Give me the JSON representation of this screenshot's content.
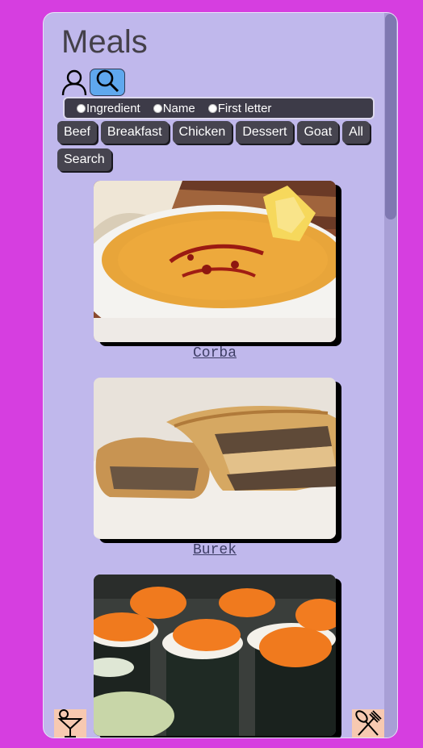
{
  "app": {
    "title": "Meals"
  },
  "search_modes": [
    {
      "label": "Ingredient"
    },
    {
      "label": "Name"
    },
    {
      "label": "First letter"
    }
  ],
  "categories": [
    "Beef",
    "Breakfast",
    "Chicken",
    "Dessert",
    "Goat",
    "All"
  ],
  "search_button_label": "Search",
  "meals": [
    {
      "name": "Corba",
      "image": "lentil-soup-photo"
    },
    {
      "name": "Burek",
      "image": "meat-pastry-photo"
    },
    {
      "name": "",
      "image": "sushi-rolls-photo"
    }
  ],
  "colors": {
    "page_bg": "#d63ee0",
    "panel_bg": "#c0b8ec",
    "chip_bg": "#46444f",
    "search_toggle_bg": "#5fa8ee",
    "corner_button_bg": "#f7c9b1"
  },
  "icons": {
    "profile": "user-icon",
    "search": "search-icon",
    "drinks": "cocktail-glass-icon",
    "food": "fork-spoon-icon"
  }
}
